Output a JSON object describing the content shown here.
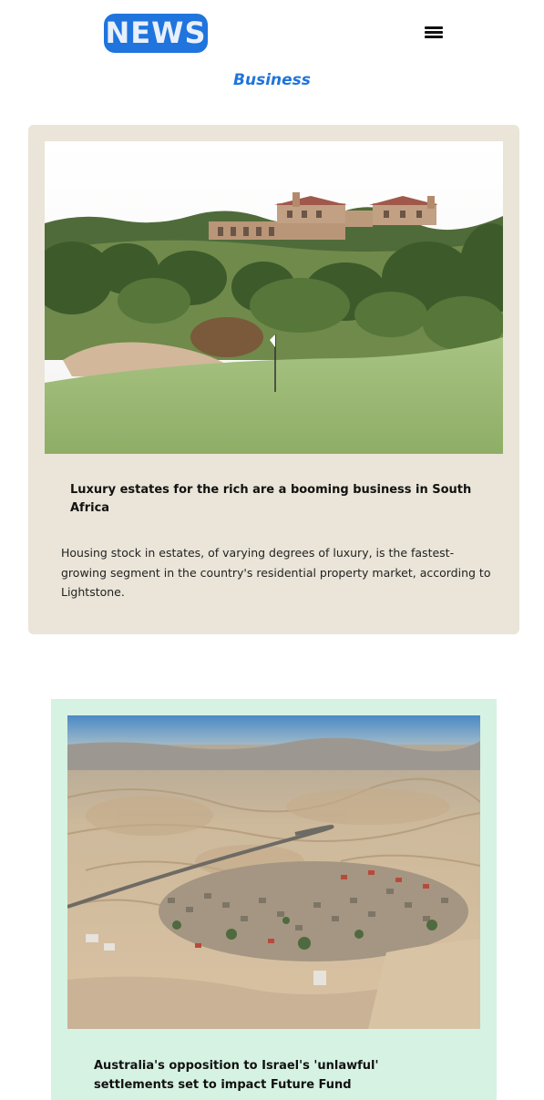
{
  "header": {
    "logo_text": "NEWS",
    "menu_icon": "hamburger-menu-icon"
  },
  "section": {
    "title": "Business"
  },
  "articles": [
    {
      "headline": "Luxury estates for the rich are a booming business in South Africa",
      "summary": "Housing stock in estates, of varying degrees of luxury, is the fastest-growing segment in the country's residential property market, according to Lightstone.",
      "card_color": "#eae5d8"
    },
    {
      "headline": "Australia's opposition to Israel's 'unlawful' settlements set to impact Future Fund",
      "card_color": "#d6f2e3"
    }
  ],
  "colors": {
    "accent": "#1f74dd"
  }
}
